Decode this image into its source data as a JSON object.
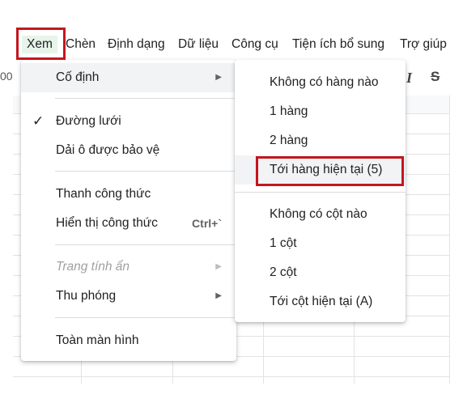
{
  "menubar": {
    "items": [
      "Xem",
      "Chèn",
      "Định dạng",
      "Dữ liệu",
      "Công cụ",
      "Tiện ích bổ sung",
      "Trợ giúp"
    ]
  },
  "toolbar": {
    "edge_glyph": "00",
    "italic": "I",
    "strike": "S"
  },
  "view_menu": {
    "freeze": "Cố định",
    "gridlines": "Đường lưới",
    "protected_ranges": "Dải ô được bảo vệ",
    "formula_bar": "Thanh công thức",
    "show_formulas": "Hiển thị công thức",
    "show_formulas_shortcut": "Ctrl+`",
    "hidden_sheets": "Trang tính ẩn",
    "zoom": "Thu phóng",
    "full_screen": "Toàn màn hình"
  },
  "freeze_menu": {
    "no_rows": "Không có hàng nào",
    "one_row": "1 hàng",
    "two_rows": "2 hàng",
    "up_to_current_row": "Tới hàng hiện tại (5)",
    "no_columns": "Không có cột nào",
    "one_column": "1 cột",
    "two_columns": "2 cột",
    "up_to_current_column": "Tới cột hiện tại (A)"
  },
  "colors": {
    "highlight": "#c5161d",
    "active_menu_bg": "#e6f4ea",
    "hover_bg": "#f1f3f4"
  },
  "icons": {
    "submenu": "triangle-right-icon",
    "check": "check-icon"
  }
}
